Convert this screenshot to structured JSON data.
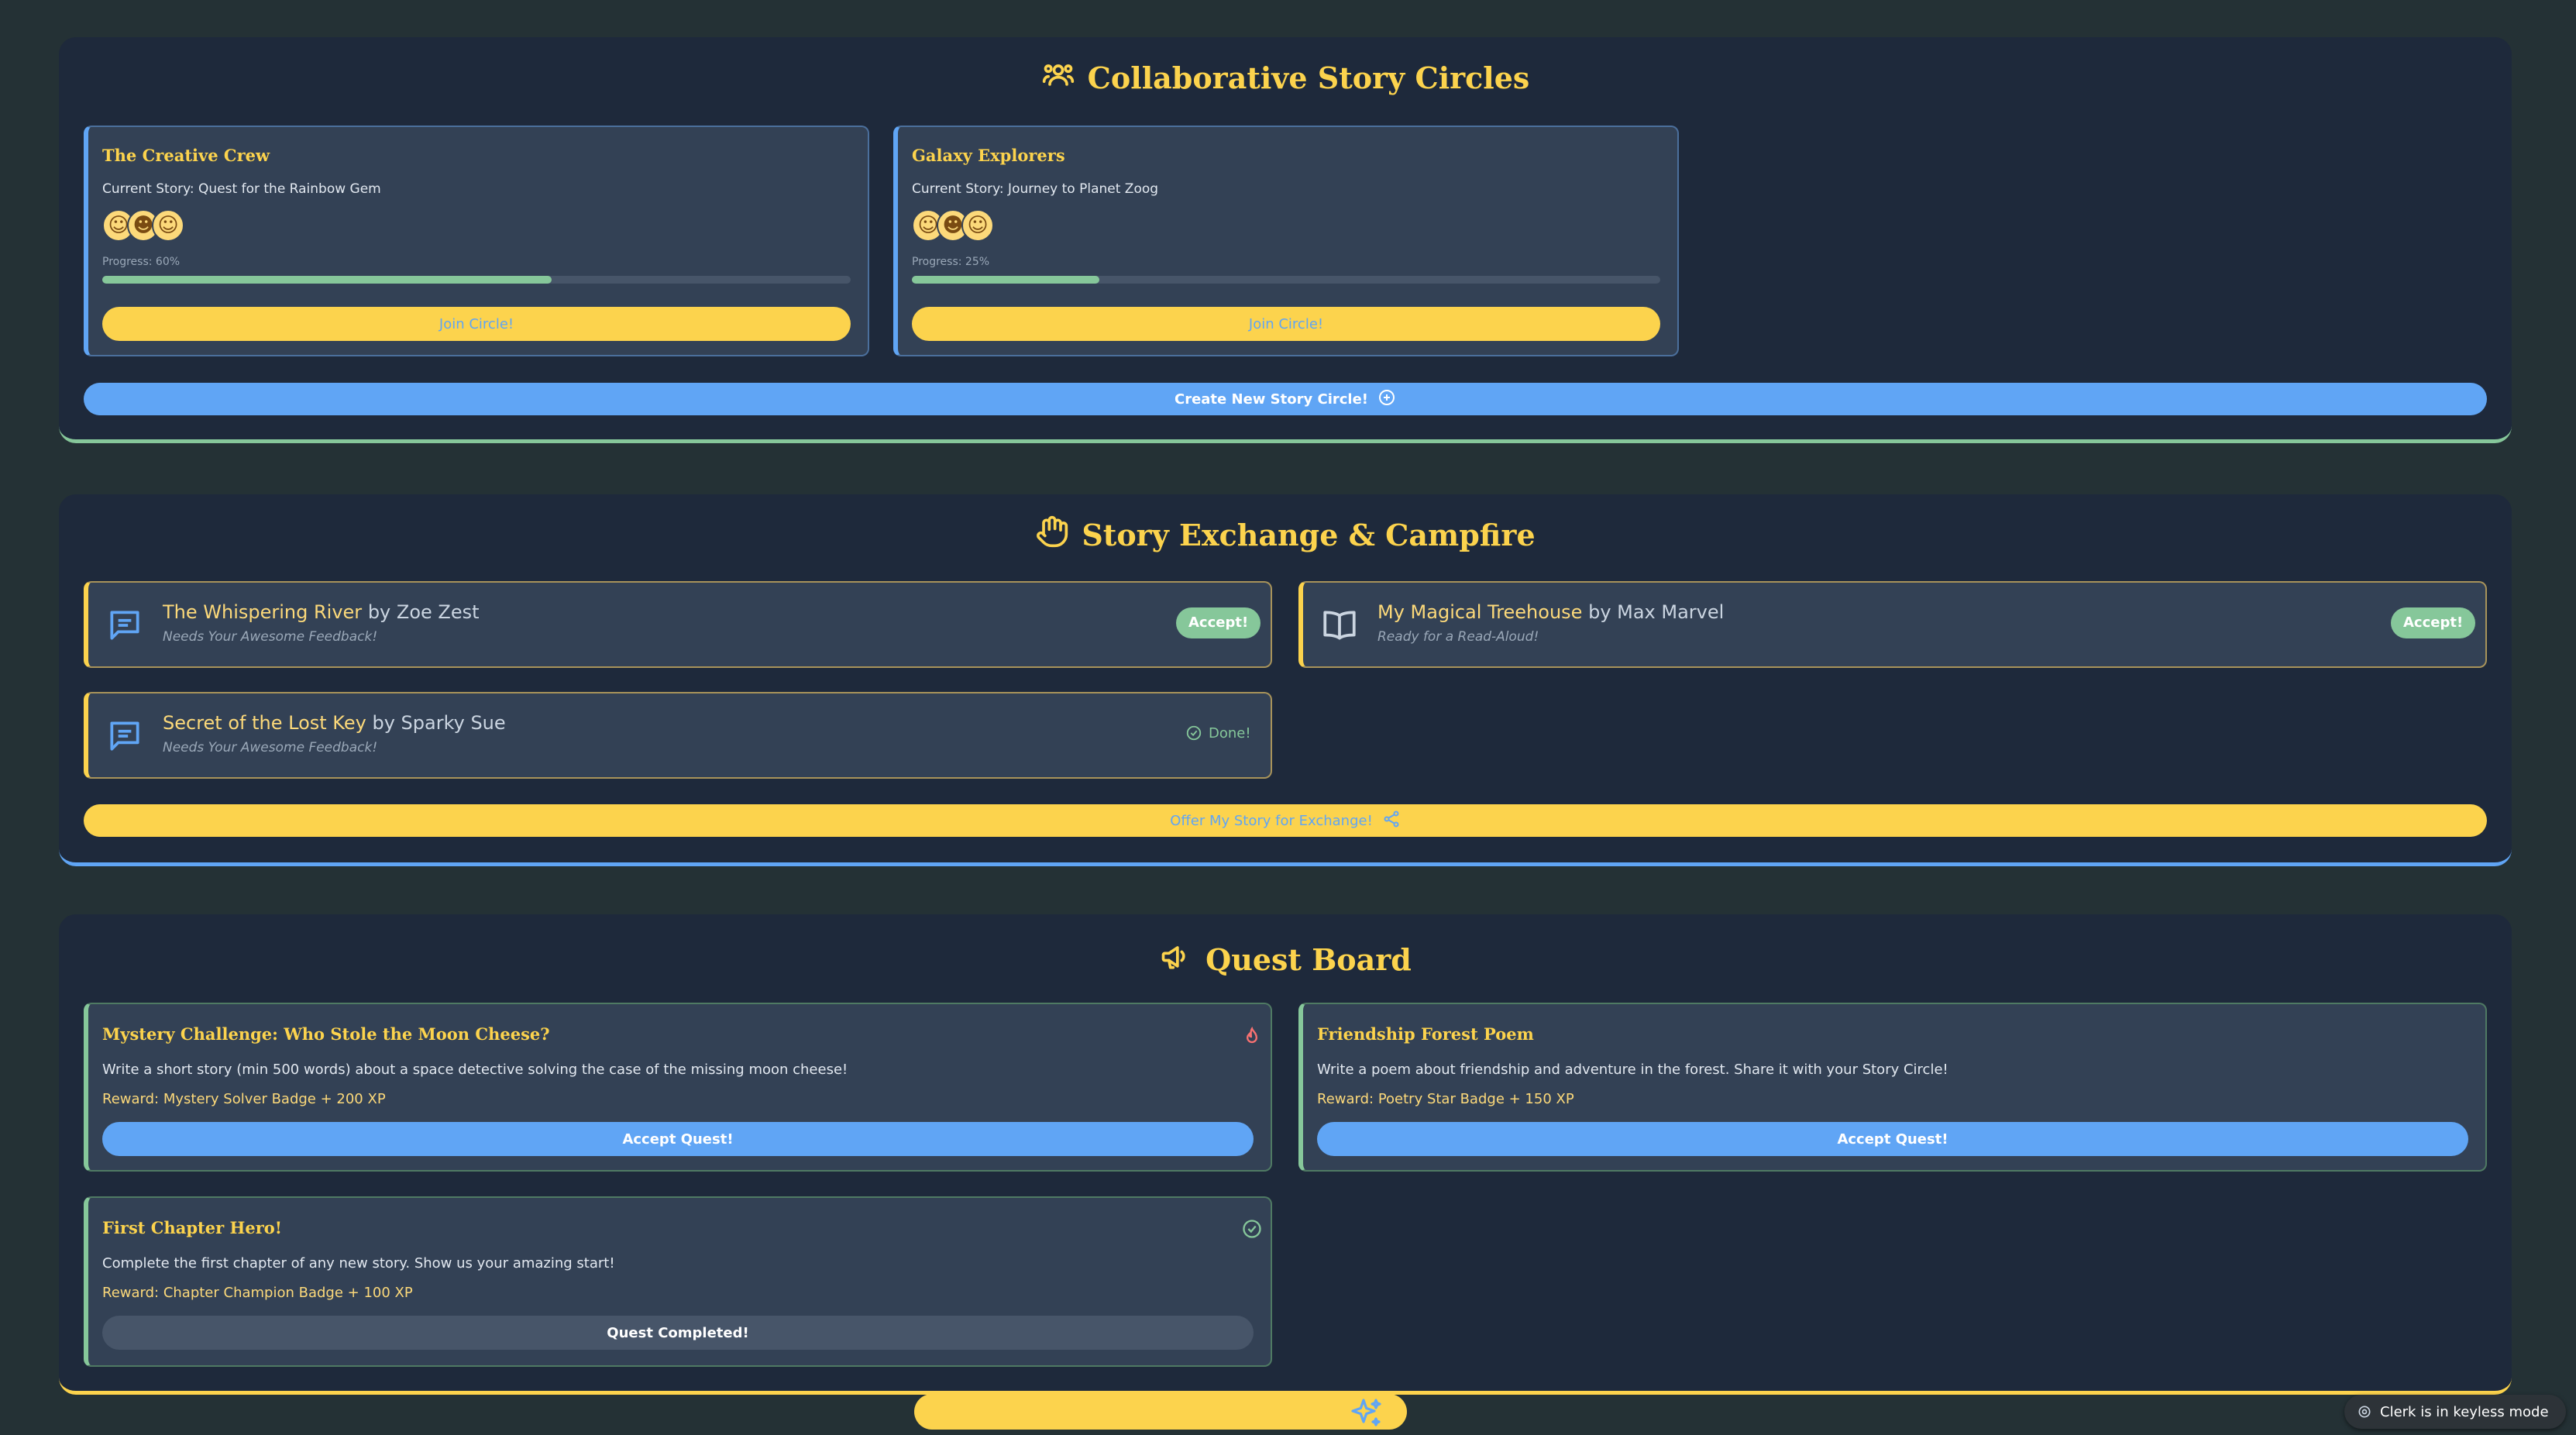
{
  "circles_section": {
    "title": "Collaborative Story Circles",
    "icon": "users-icon",
    "cards": [
      {
        "name": "The Creative Crew",
        "story_label": "Current Story: Quest for the Rainbow Gem",
        "progress_label": "Progress: 60%",
        "progress": 0.6,
        "join_label": "Join Circle!"
      },
      {
        "name": "Galaxy Explorers",
        "story_label": "Current Story: Journey to Planet Zoog",
        "progress_label": "Progress: 25%",
        "progress": 0.25,
        "join_label": "Join Circle!"
      }
    ],
    "create_label": "Create New Story Circle!"
  },
  "exchange_section": {
    "title": "Story Exchange & Campfire",
    "icon": "hand-icon",
    "stories": [
      {
        "title": "The Whispering River",
        "by": "by Zoe Zest",
        "subtitle": "Needs Your Awesome Feedback!",
        "action": "Accept!",
        "icon": "message-icon"
      },
      {
        "title": "My Magical Treehouse",
        "by": "by Max Marvel",
        "subtitle": "Ready for a Read-Aloud!",
        "action": "Accept!",
        "icon": "book-icon"
      },
      {
        "title": "Secret of the Lost Key",
        "by": "by Sparky Sue",
        "subtitle": "Needs Your Awesome Feedback!",
        "action": "Done!",
        "icon": "message-icon"
      }
    ],
    "offer_label": "Offer My Story for Exchange!"
  },
  "quest_section": {
    "title": "Quest Board",
    "icon": "megaphone-icon",
    "quests": [
      {
        "title": "Mystery Challenge: Who Stole the Moon Cheese?",
        "desc": "Write a short story (min 500 words) about a space detective solving the case of the missing moon cheese!",
        "reward": "Reward: Mystery Solver Badge + 200 XP",
        "button": "Accept Quest!"
      },
      {
        "title": "Friendship Forest Poem",
        "desc": "Write a poem about friendship and adventure in the forest. Share it with your Story Circle!",
        "reward": "Reward: Poetry Star Badge + 150 XP",
        "button": "Accept Quest!"
      },
      {
        "title": "First Chapter Hero!",
        "desc": "Complete the first chapter of any new story. Show us your amazing start!",
        "reward": "Reward: Chapter Champion Badge + 100 XP",
        "button": "Quest Completed!"
      }
    ]
  },
  "keyless_badge": "Clerk is in keyless mode",
  "colors": {
    "accent_yellow": "#fcd34d",
    "accent_blue": "#60a5f5",
    "accent_green": "#86c79a",
    "panel_bg": "#1e293b",
    "card_bg": "#334155"
  }
}
